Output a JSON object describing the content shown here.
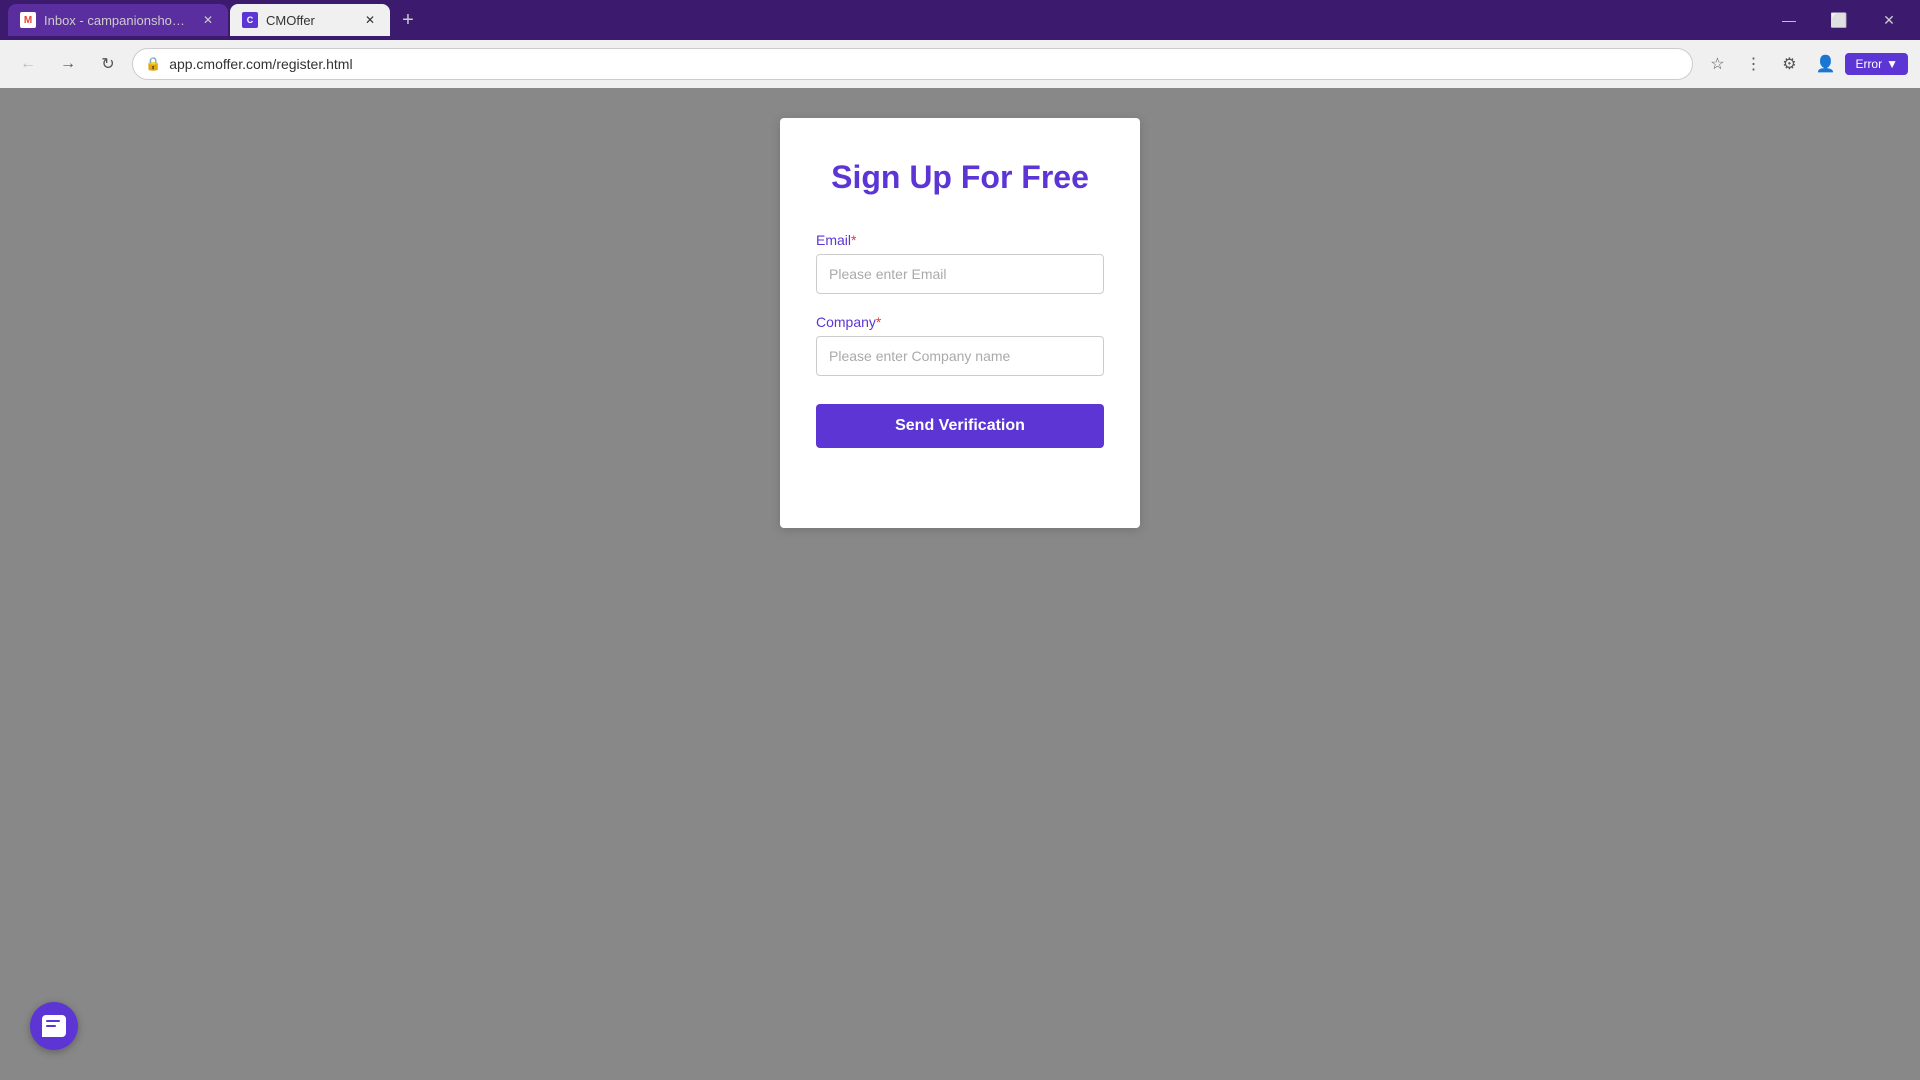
{
  "browser": {
    "tabs": [
      {
        "id": "tab-gmail",
        "label": "Inbox - campanionshop@gmail....",
        "favicon_type": "gmail",
        "active": false
      },
      {
        "id": "tab-cmoffer",
        "label": "CMOffer",
        "favicon_type": "cmoffer",
        "active": true
      }
    ],
    "address_bar": {
      "url": "app.cmoffer.com/register.html",
      "lock_icon": "🔒"
    },
    "window_controls": {
      "minimize": "—",
      "maximize": "⬜",
      "close": "✕"
    },
    "new_tab_icon": "+",
    "error_badge_label": "Error"
  },
  "page": {
    "title": "Sign Up For Free",
    "form": {
      "email_label": "Email",
      "email_required": "*",
      "email_placeholder": "Please enter Email",
      "company_label": "Company",
      "company_required": "*",
      "company_placeholder": "Please enter Company name",
      "submit_label": "Send Verification"
    }
  },
  "colors": {
    "brand_purple": "#5c35d4",
    "required_red": "#e53935",
    "background_gray": "#888888"
  }
}
